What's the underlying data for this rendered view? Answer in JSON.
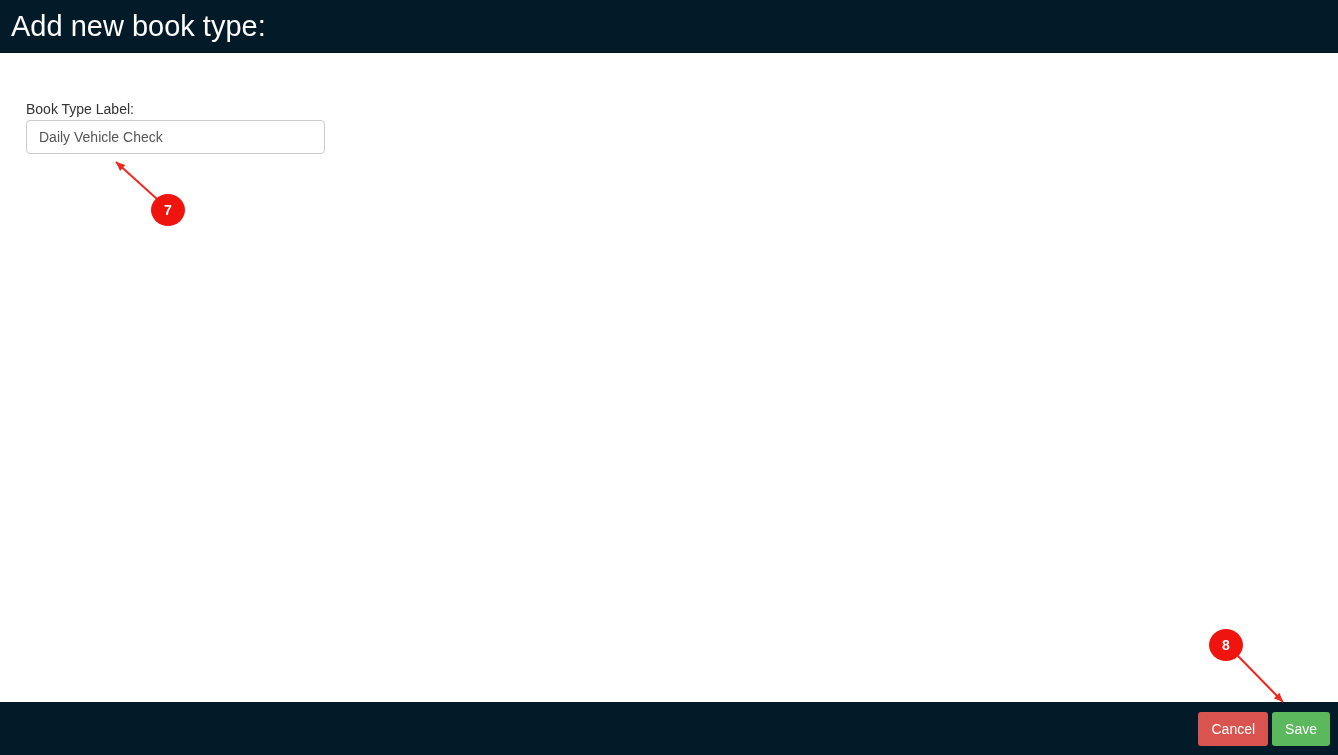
{
  "header": {
    "title": "Add new book type:"
  },
  "form": {
    "label": "Book Type Label:",
    "value": "Daily Vehicle Check"
  },
  "footer": {
    "buttons": [
      {
        "kind": "cancel",
        "label": "Cancel"
      },
      {
        "kind": "save",
        "label": "Save"
      }
    ]
  },
  "annotations": [
    {
      "number": "7"
    },
    {
      "number": "8"
    }
  ]
}
